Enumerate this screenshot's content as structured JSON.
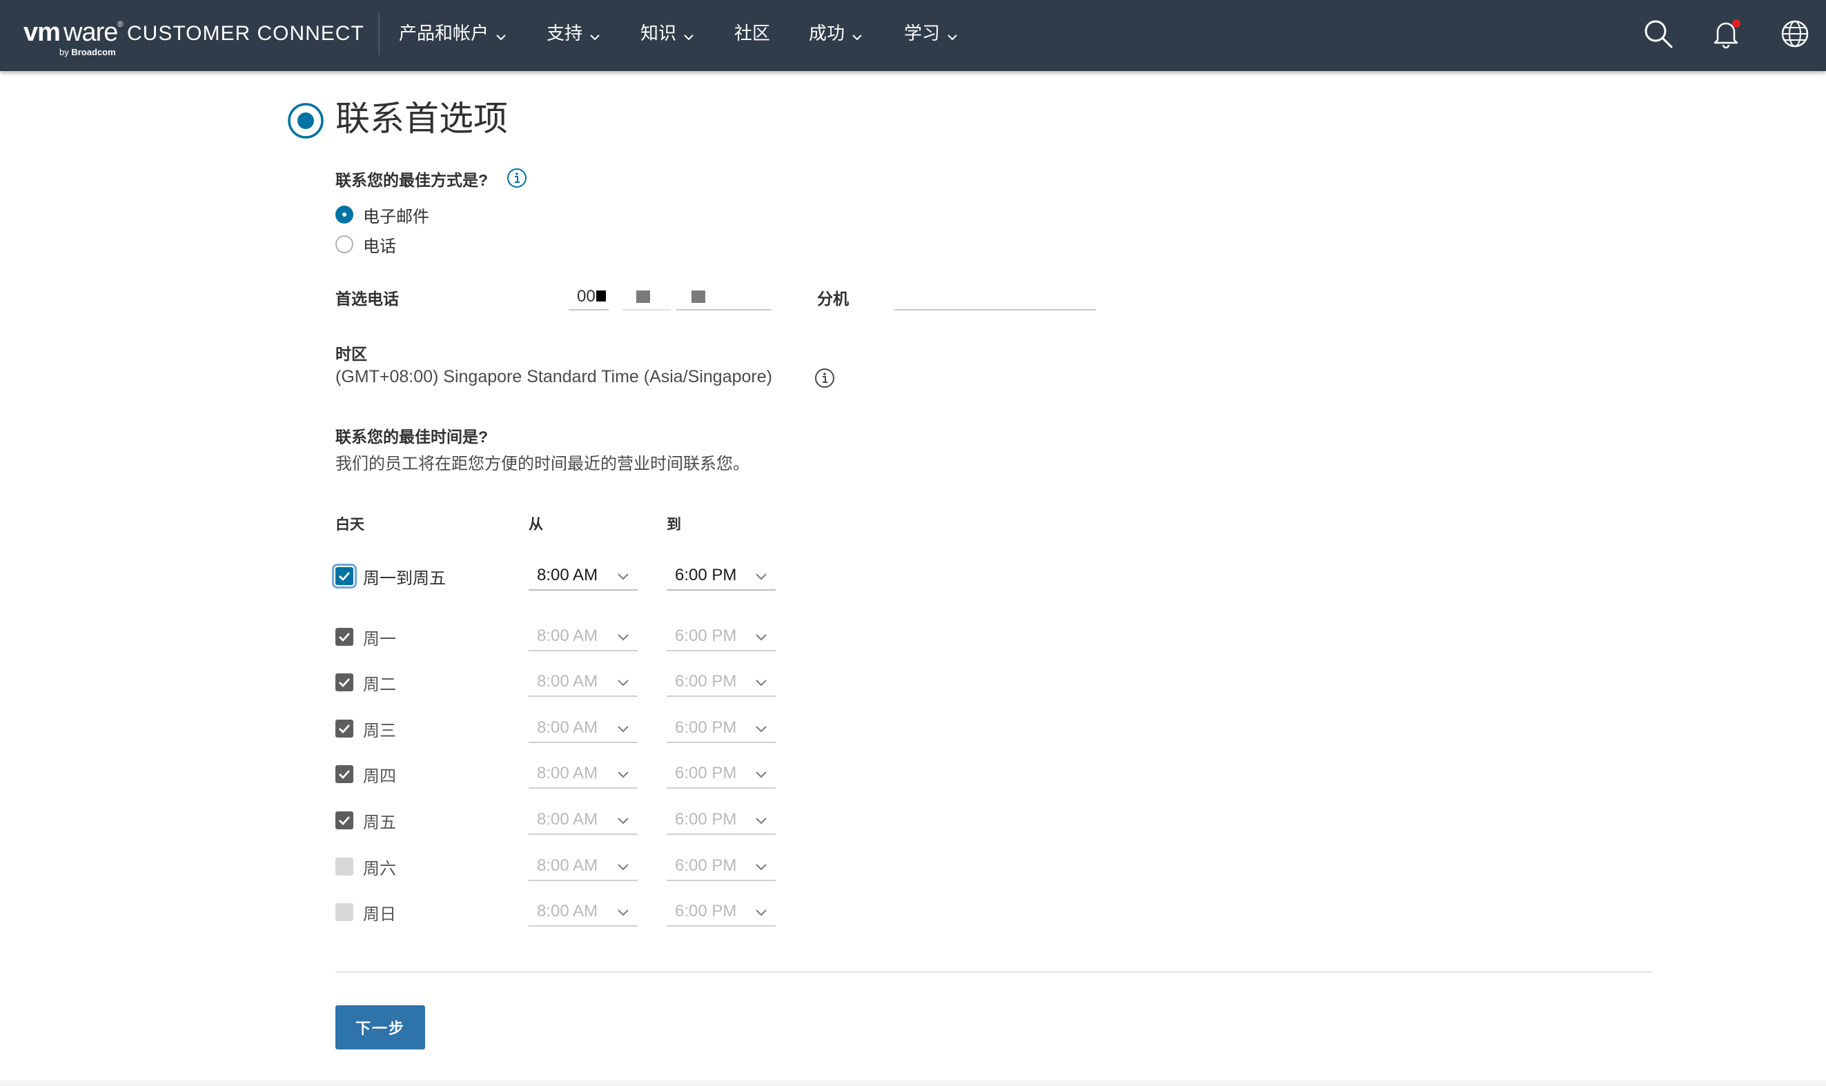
{
  "header": {
    "logo_vm": "vm",
    "logo_ware": "ware",
    "logo_reg": "®",
    "logo_cc": "CUSTOMER CONNECT",
    "logo_by": "by",
    "logo_broadcom": "Broadcom",
    "nav": [
      {
        "label": "产品和帐户",
        "has_menu": true
      },
      {
        "label": "支持",
        "has_menu": true
      },
      {
        "label": "知识",
        "has_menu": true
      },
      {
        "label": "社区",
        "has_menu": false
      },
      {
        "label": "成功",
        "has_menu": true
      },
      {
        "label": "学习",
        "has_menu": true
      }
    ],
    "icons": [
      "search-icon",
      "bell-icon",
      "globe-icon"
    ],
    "notification_dot_color": "#e02020"
  },
  "page": {
    "title": "联系首选项",
    "contact_method_label": "联系您的最佳方式是?",
    "options": [
      "电子邮件",
      "电话"
    ],
    "selected_option": "电子邮件",
    "phone_label": "首选电话",
    "phone_prefix": "00",
    "extension_label": "分机",
    "extension_value": "",
    "timezone_label": "时区",
    "timezone_value": "(GMT+08:00) Singapore Standard Time (Asia/Singapore)",
    "best_time_label": "联系您的最佳时间是?",
    "best_time_desc": "我们的员工将在距您方便的时间最近的营业时间联系您。",
    "col_day": "白天",
    "col_from": "从",
    "col_to": "到",
    "master_row": {
      "label": "周一到周五",
      "checked": true,
      "from": "8:00 AM",
      "to": "6:00 PM"
    },
    "days": [
      {
        "label": "周一",
        "checked": true,
        "from": "8:00 AM",
        "to": "6:00 PM"
      },
      {
        "label": "周二",
        "checked": true,
        "from": "8:00 AM",
        "to": "6:00 PM"
      },
      {
        "label": "周三",
        "checked": true,
        "from": "8:00 AM",
        "to": "6:00 PM"
      },
      {
        "label": "周四",
        "checked": true,
        "from": "8:00 AM",
        "to": "6:00 PM"
      },
      {
        "label": "周五",
        "checked": true,
        "from": "8:00 AM",
        "to": "6:00 PM"
      },
      {
        "label": "周六",
        "checked": false,
        "from": "8:00 AM",
        "to": "6:00 PM"
      },
      {
        "label": "周日",
        "checked": false,
        "from": "8:00 AM",
        "to": "6:00 PM"
      }
    ],
    "next_button": "下一步"
  },
  "colors": {
    "header_bg": "#313c4a",
    "accent": "#0072a3",
    "button": "#2e73aa"
  }
}
